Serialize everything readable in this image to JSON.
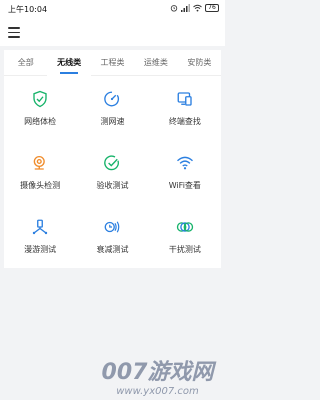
{
  "status_bar": {
    "time": "上午10:04",
    "battery": "76"
  },
  "tabs": [
    {
      "label": "全部"
    },
    {
      "label": "无线类",
      "active": true
    },
    {
      "label": "工程类"
    },
    {
      "label": "运维类"
    },
    {
      "label": "安防类"
    }
  ],
  "tools": [
    {
      "label": "网络体检",
      "icon": "shield-check-icon",
      "color": "#17b36a"
    },
    {
      "label": "测网速",
      "icon": "speedometer-icon",
      "color": "#2b7fe0"
    },
    {
      "label": "终端查找",
      "icon": "device-search-icon",
      "color": "#2b7fe0"
    },
    {
      "label": "摄像头检测",
      "icon": "camera-icon",
      "color": "#f08c2b"
    },
    {
      "label": "验收测试",
      "icon": "check-circle-icon",
      "color": "#17b36a"
    },
    {
      "label": "WiFi查看",
      "icon": "wifi-icon",
      "color": "#2b7fe0"
    },
    {
      "label": "漫游测试",
      "icon": "roaming-icon",
      "color": "#2b7fe0"
    },
    {
      "label": "衰减测试",
      "icon": "attenuation-icon",
      "color": "#2b7fe0"
    },
    {
      "label": "干扰测试",
      "icon": "interference-icon",
      "color": "#17b36a"
    }
  ],
  "watermark": {
    "title": "007游戏网",
    "url": "www.yx007.com"
  }
}
